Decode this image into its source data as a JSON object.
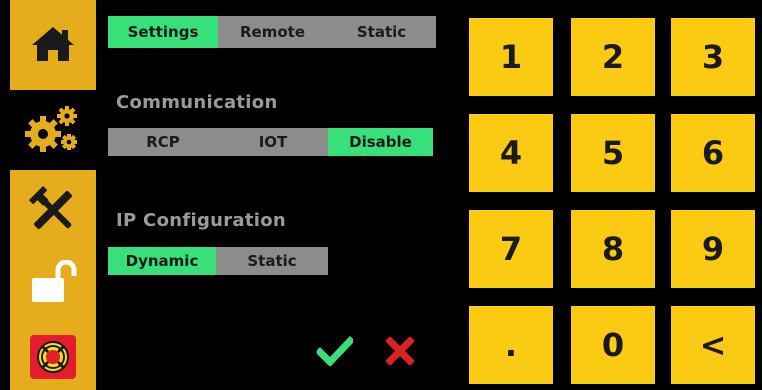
{
  "sidebar": {
    "items": [
      {
        "icon": "home-icon"
      },
      {
        "icon": "gears-icon"
      },
      {
        "icon": "tools-icon"
      },
      {
        "icon": "unlock-icon"
      },
      {
        "icon": "lifebuoy-icon"
      }
    ]
  },
  "tabs": {
    "items": [
      "Settings",
      "Remote",
      "Static"
    ],
    "selected": "Settings"
  },
  "communication": {
    "label": "Communication",
    "options": [
      "RCP",
      "IOT",
      "Disable"
    ],
    "selected": "Disable"
  },
  "ip_config": {
    "label": "IP Configuration",
    "options": [
      "Dynamic",
      "Static"
    ],
    "selected": "Dynamic"
  },
  "keypad": {
    "keys": [
      "1",
      "2",
      "3",
      "4",
      "5",
      "6",
      "7",
      "8",
      "9",
      ".",
      "0",
      "<"
    ]
  },
  "actions": {
    "confirm_icon": "checkmark-icon",
    "cancel_icon": "close-icon"
  },
  "colors": {
    "accent_yellow": "#fbcb13",
    "sidebar_gold": "#e5ac1c",
    "selected_green": "#38e07a",
    "unselected_gray": "#8c8c8c",
    "cancel_red": "#e02020",
    "background": "#000000"
  }
}
